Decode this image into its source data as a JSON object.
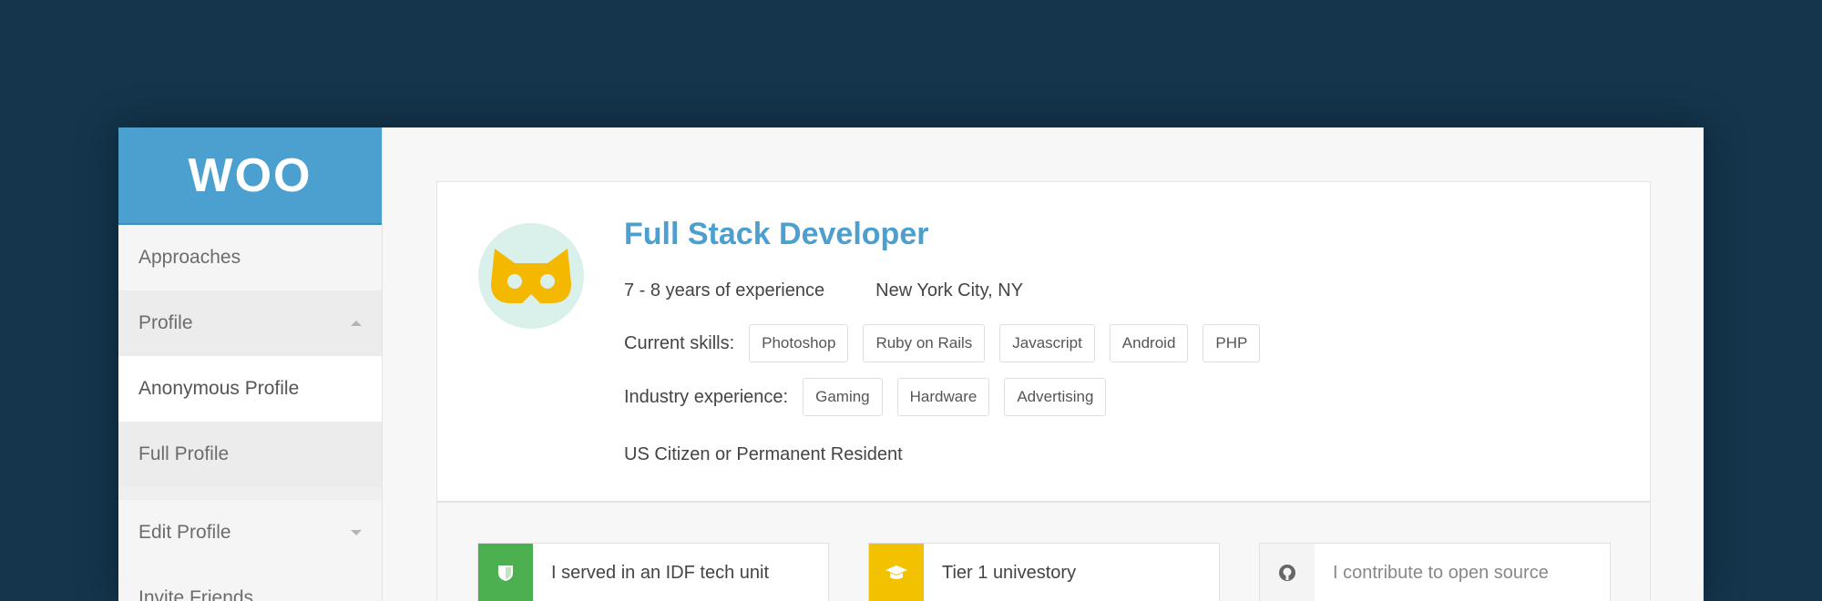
{
  "app": {
    "logo": "WOO"
  },
  "sidebar": {
    "items": [
      {
        "label": "Approaches"
      },
      {
        "label": "Profile"
      },
      {
        "label": "Anonymous Profile"
      },
      {
        "label": "Full Profile"
      },
      {
        "label": "Edit Profile"
      },
      {
        "label": "Invite Friends"
      }
    ]
  },
  "profile": {
    "title": "Full Stack Developer",
    "experience": "7 - 8 years of experience",
    "location": "New York City, NY",
    "skills_label": "Current skills:",
    "skills": [
      "Photoshop",
      "Ruby on Rails",
      "Javascript",
      "Android",
      "PHP"
    ],
    "industry_label": "Industry experience:",
    "industries": [
      "Gaming",
      "Hardware",
      "Advertising"
    ],
    "citizenship": "US Citizen or Permanent Resident"
  },
  "badges": [
    {
      "label": "I served in an IDF tech unit",
      "icon": "shield-icon",
      "color": "#4caf50"
    },
    {
      "label": "Tier 1 univestory",
      "icon": "graduation-cap-icon",
      "color": "#f2c200"
    },
    {
      "label": "I contribute to open source",
      "icon": "github-icon",
      "color": "#f4f4f4"
    }
  ],
  "colors": {
    "background": "#14354c",
    "accent": "#4ba0cf",
    "avatar_bg": "#d9f1ea",
    "avatar_fg": "#f5b800"
  }
}
